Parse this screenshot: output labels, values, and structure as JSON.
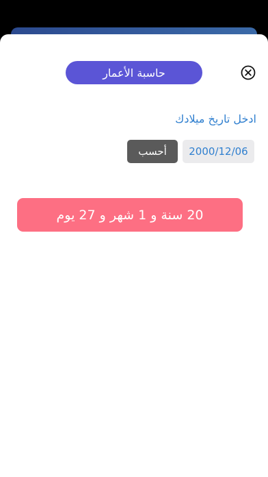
{
  "header": {
    "title": "حاسبة الأعمار",
    "close_icon": "close-circle-icon"
  },
  "form": {
    "prompt": "ادخل تاريخ ميلادك",
    "birth_date": "2000/12/06",
    "calculate_label": "أحسب"
  },
  "result": {
    "text": "20 سنة و 1 شهر و 27 يوم"
  },
  "colors": {
    "title_bg": "#5b55d6",
    "accent_text": "#2f7fcf",
    "button_bg": "#5a5a5a",
    "result_bg": "#fd6f83"
  }
}
